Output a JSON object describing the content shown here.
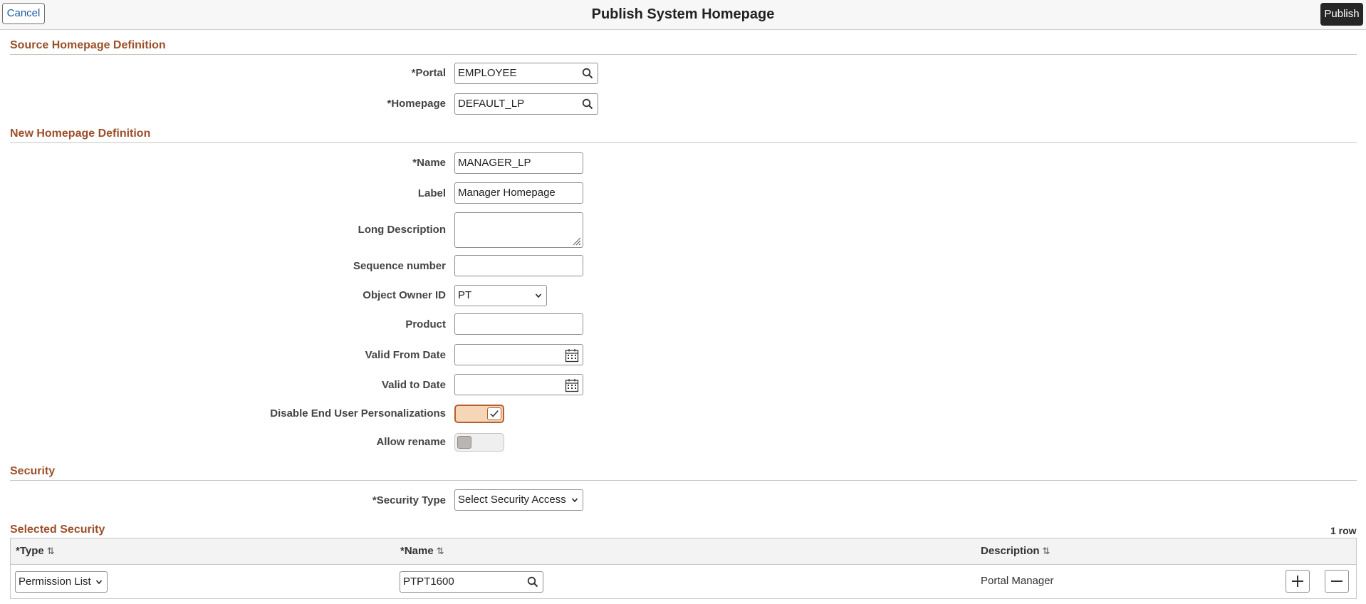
{
  "header": {
    "title": "Publish System Homepage",
    "cancel_label": "Cancel",
    "publish_label": "Publish"
  },
  "source_section": {
    "title": "Source Homepage Definition",
    "portal": {
      "req": "*",
      "label": "Portal",
      "value": "EMPLOYEE"
    },
    "homepage": {
      "req": "*",
      "label": "Homepage",
      "value": "DEFAULT_LP"
    }
  },
  "new_section": {
    "title": "New Homepage Definition",
    "name": {
      "req": "*",
      "label": "Name",
      "value": "MANAGER_LP"
    },
    "label_field": {
      "label": "Label",
      "value": "Manager Homepage"
    },
    "long_description": {
      "label": "Long Description",
      "value": ""
    },
    "sequence_number": {
      "label": "Sequence number",
      "value": ""
    },
    "object_owner_id": {
      "label": "Object Owner ID",
      "value": "PT"
    },
    "product": {
      "label": "Product",
      "value": ""
    },
    "valid_from_date": {
      "label": "Valid From Date",
      "value": ""
    },
    "valid_to_date": {
      "label": "Valid to Date",
      "value": ""
    },
    "disable_personalizations": {
      "label": "Disable End User Personalizations",
      "checked": true
    },
    "allow_rename": {
      "label": "Allow rename",
      "checked": false
    }
  },
  "security_section": {
    "title": "Security",
    "security_type": {
      "req": "*",
      "label": "Security Type",
      "value": "Select Security Access"
    }
  },
  "selected_security": {
    "title": "Selected Security",
    "row_count": "1 row",
    "columns": {
      "type": {
        "req": "*",
        "label": "Type"
      },
      "name": {
        "req": "*",
        "label": "Name"
      },
      "description": {
        "label": "Description"
      }
    },
    "rows": [
      {
        "type": "Permission List",
        "name": "PTPT1600",
        "description": "Portal Manager"
      }
    ]
  },
  "colors": {
    "section_header": "#9c4f2a",
    "toggle_on_border": "#b5602e",
    "toggle_on_fill": "#f7d6b8",
    "link_blue": "#1a5aa6",
    "publish_bg": "#262626"
  }
}
